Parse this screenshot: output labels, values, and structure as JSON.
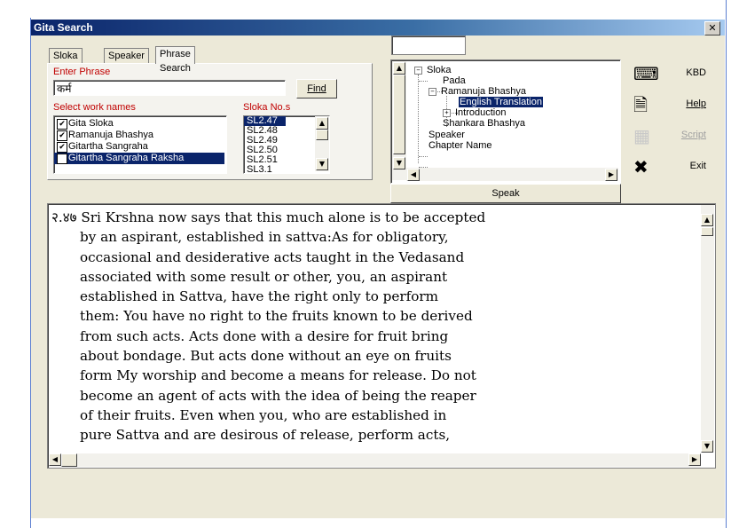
{
  "window": {
    "title": "Gita Search",
    "close_glyph": "✕"
  },
  "tabs": [
    {
      "label": "Sloka No."
    },
    {
      "label": "Speaker"
    },
    {
      "label": "Phrase Search",
      "active": true
    }
  ],
  "phrase": {
    "label": "Enter Phrase",
    "value": "कर्म",
    "find_button": "Find"
  },
  "works": {
    "label": "Select work names",
    "items": [
      {
        "label": "Gita Sloka",
        "checked": true
      },
      {
        "label": "Ramanuja Bhashya",
        "checked": true
      },
      {
        "label": "Gitartha Sangraha",
        "checked": true
      },
      {
        "label": "Gitartha Sangraha Raksha",
        "checked": true,
        "selected": true
      }
    ]
  },
  "slokas": {
    "label": "Sloka No.s",
    "items": [
      "SL2.47",
      "SL2.48",
      "SL2.49",
      "SL2.50",
      "SL2.51",
      "SL3.1"
    ],
    "selected_index": 0
  },
  "search_box": {
    "value": ""
  },
  "tree": {
    "sloka": "Sloka",
    "pada": "Pada",
    "ramanuja": "Ramanuja Bhashya",
    "english": "English Translation",
    "introduction": "Introduction",
    "shankara": "Shankara Bhashya",
    "speaker": "Speaker",
    "chapter": "Chapter Name"
  },
  "speak_button": "Speak",
  "side_buttons": {
    "kbd": {
      "label": "KBD",
      "icon": "keyboard-icon"
    },
    "help": {
      "label": "Help",
      "icon": "help-document-icon"
    },
    "script": {
      "label": "Script",
      "icon": "script-icon",
      "disabled": true
    },
    "exit": {
      "label": "Exit",
      "icon": "exit-x-icon"
    }
  },
  "content": {
    "lines": [
      "२.४७ Sri Krshna now says that this much alone is to be accepted",
      "by an aspirant, established in sattva:As for obligatory,",
      "occasional and desiderative acts taught in the Vedasand",
      "associated with some result or other, you, an aspirant",
      "established in Sattva, have the right only to perform",
      "them: You have no right to the fruits known to be derived",
      "from such acts. Acts done with a desire for fruit bring",
      "about bondage. But acts done without an eye on fruits",
      "form My worship and become a means for release. Do not",
      "become an agent of acts with the idea of being the reaper",
      "of their fruits. Even when you, who are established in",
      "pure Sattva and are desirous of release, perform acts,"
    ]
  }
}
